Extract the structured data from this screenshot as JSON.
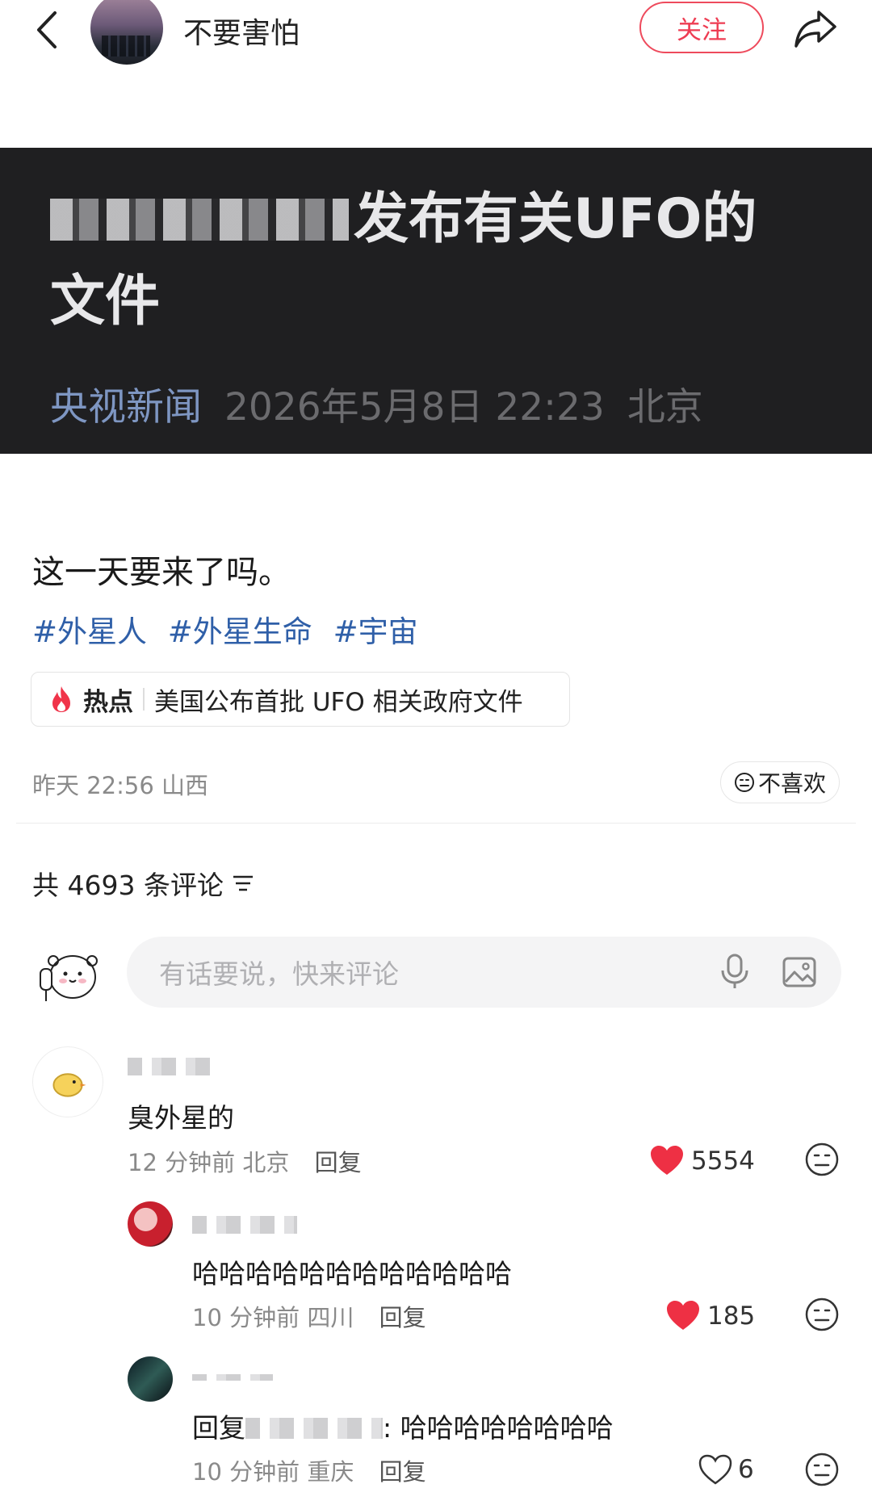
{
  "header": {
    "username": "不要害怕",
    "follow_label": "关注"
  },
  "news_card": {
    "title_suffix_line1": "发布有关UFO的",
    "title_line2": "文件",
    "source": "央视新闻",
    "time": "2026年5月8日 22:23",
    "location": "北京"
  },
  "post": {
    "text": "这一天要来了吗。",
    "tags": [
      "#外星人",
      "#外星生命",
      "#宇宙"
    ],
    "hot_label": "热点",
    "hot_title": "美国公布首批 UFO 相关政府文件",
    "meta": "昨天 22:56 山西",
    "dislike_label": "不喜欢"
  },
  "comments_section": {
    "count_text": "共 4693 条评论",
    "input_placeholder": "有话要说，快来评论"
  },
  "comments": [
    {
      "text": "臭外星的",
      "time": "12 分钟前",
      "location": "北京",
      "reply_label": "回复",
      "likes": "5554"
    },
    {
      "text": "哈哈哈哈哈哈哈哈哈哈哈哈",
      "time": "10 分钟前",
      "location": "四川",
      "reply_label": "回复",
      "likes": "185"
    },
    {
      "text_prefix": "回复",
      "text_suffix": ": 哈哈哈哈哈哈哈哈",
      "time": "10 分钟前",
      "location": "重庆",
      "reply_label": "回复",
      "likes": "6"
    }
  ],
  "colors": {
    "accent_red": "#ee3c52",
    "tag_blue": "#2f5fa8",
    "banner_bg": "#1f1f21",
    "source_blue": "#7e96c2"
  }
}
